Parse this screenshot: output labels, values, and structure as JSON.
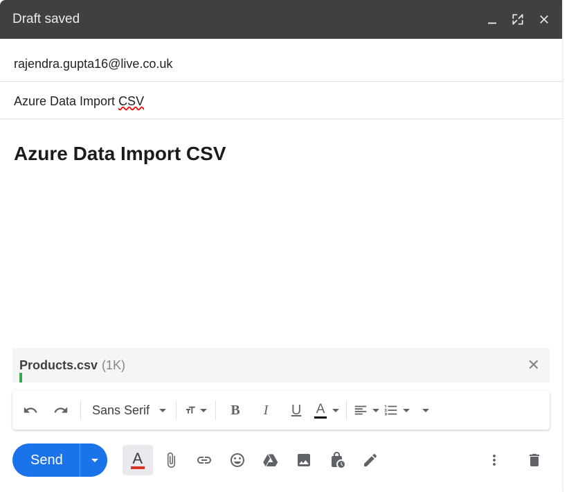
{
  "header": {
    "title": "Draft saved"
  },
  "recipients": {
    "to": "rajendra.gupta16@live.co.uk"
  },
  "subject": {
    "prefix": "Azure Data Import ",
    "misspelled": "CSV"
  },
  "body": {
    "heading": "Azure Data Import CSV"
  },
  "attachment": {
    "filename": "Products.csv",
    "size": "(1K)"
  },
  "formatting": {
    "font": "Sans Serif"
  },
  "actions": {
    "send": "Send"
  }
}
